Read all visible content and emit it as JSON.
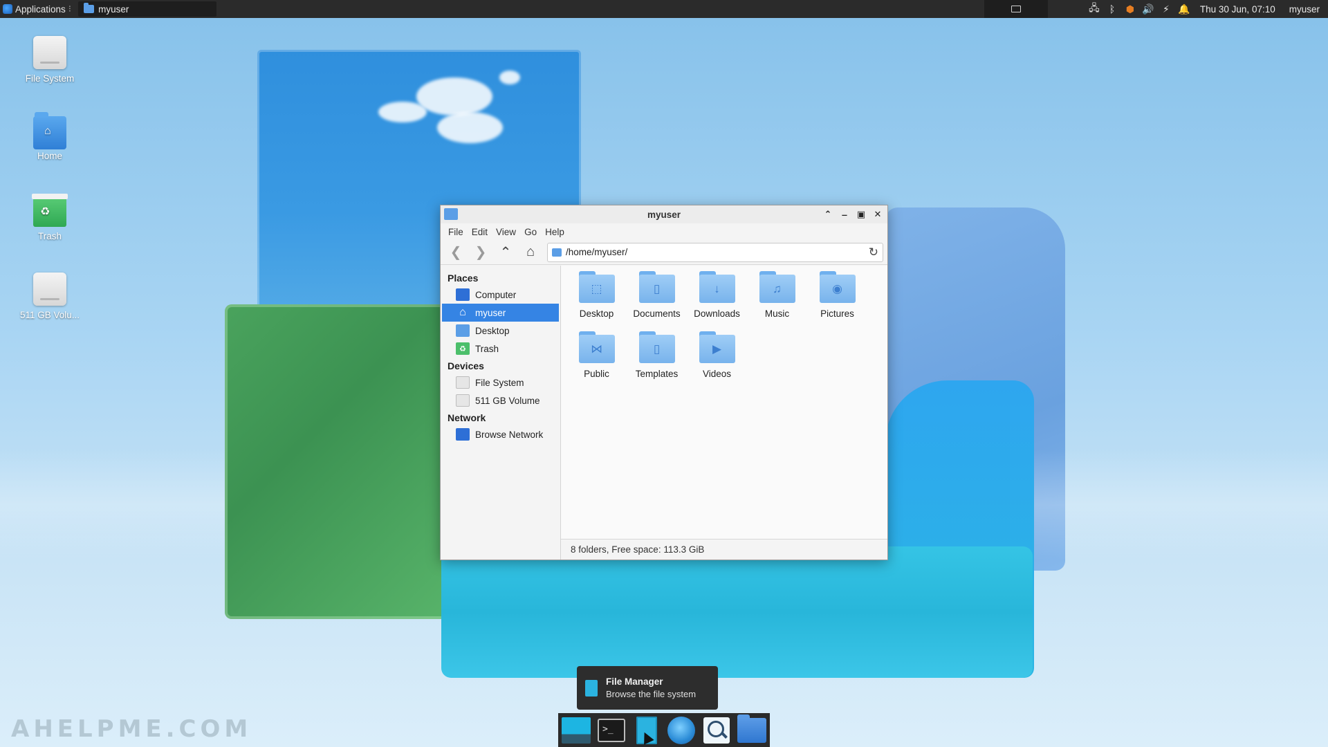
{
  "top_panel": {
    "applications_label": "Applications",
    "window_button_title": "myuser",
    "clock": "Thu 30 Jun, 07:10",
    "user": "myuser",
    "tray_icons": [
      "network-icon",
      "bluetooth-icon",
      "update-shield-icon",
      "volume-icon",
      "power-icon",
      "notification-bell-icon"
    ]
  },
  "desktop_icons": [
    {
      "label": "File System",
      "icon": "disk-icon"
    },
    {
      "label": "Home",
      "icon": "home-folder-icon"
    },
    {
      "label": "Trash",
      "icon": "trash-icon"
    },
    {
      "label": "511 GB Volu...",
      "icon": "disk-icon"
    }
  ],
  "file_manager": {
    "title": "myuser",
    "menu": [
      "File",
      "Edit",
      "View",
      "Go",
      "Help"
    ],
    "location": "/home/myuser/",
    "sidebar": {
      "places_header": "Places",
      "places": [
        {
          "label": "Computer",
          "icon": "computer-icon"
        },
        {
          "label": "myuser",
          "icon": "home-icon",
          "selected": true
        },
        {
          "label": "Desktop",
          "icon": "desktop-icon"
        },
        {
          "label": "Trash",
          "icon": "trash-icon"
        }
      ],
      "devices_header": "Devices",
      "devices": [
        {
          "label": "File System",
          "icon": "disk-icon"
        },
        {
          "label": "511 GB Volume",
          "icon": "disk-icon"
        }
      ],
      "network_header": "Network",
      "network": [
        {
          "label": "Browse Network",
          "icon": "network-icon"
        }
      ]
    },
    "folders": [
      {
        "name": "Desktop",
        "icon": "desktop-folder-icon",
        "glyph": "⬚"
      },
      {
        "name": "Documents",
        "icon": "documents-folder-icon",
        "glyph": "▯"
      },
      {
        "name": "Downloads",
        "icon": "downloads-folder-icon",
        "glyph": "↓"
      },
      {
        "name": "Music",
        "icon": "music-folder-icon",
        "glyph": "♫"
      },
      {
        "name": "Pictures",
        "icon": "pictures-folder-icon",
        "glyph": "◉"
      },
      {
        "name": "Public",
        "icon": "public-folder-icon",
        "glyph": "⋈"
      },
      {
        "name": "Templates",
        "icon": "templates-folder-icon",
        "glyph": "▯"
      },
      {
        "name": "Videos",
        "icon": "videos-folder-icon",
        "glyph": "▶"
      }
    ],
    "status": "8 folders, Free space: 113.3 GiB"
  },
  "tooltip": {
    "title": "File Manager",
    "subtitle": "Browse the file system"
  },
  "dock": [
    "show-desktop-icon",
    "terminal-icon",
    "file-manager-icon",
    "web-browser-icon",
    "app-finder-icon",
    "folder-icon"
  ],
  "watermark": "AHELPME.COM",
  "colors": {
    "selection": "#3584e4",
    "panel": "#2b2b2b",
    "folder": "#78b3ec"
  }
}
